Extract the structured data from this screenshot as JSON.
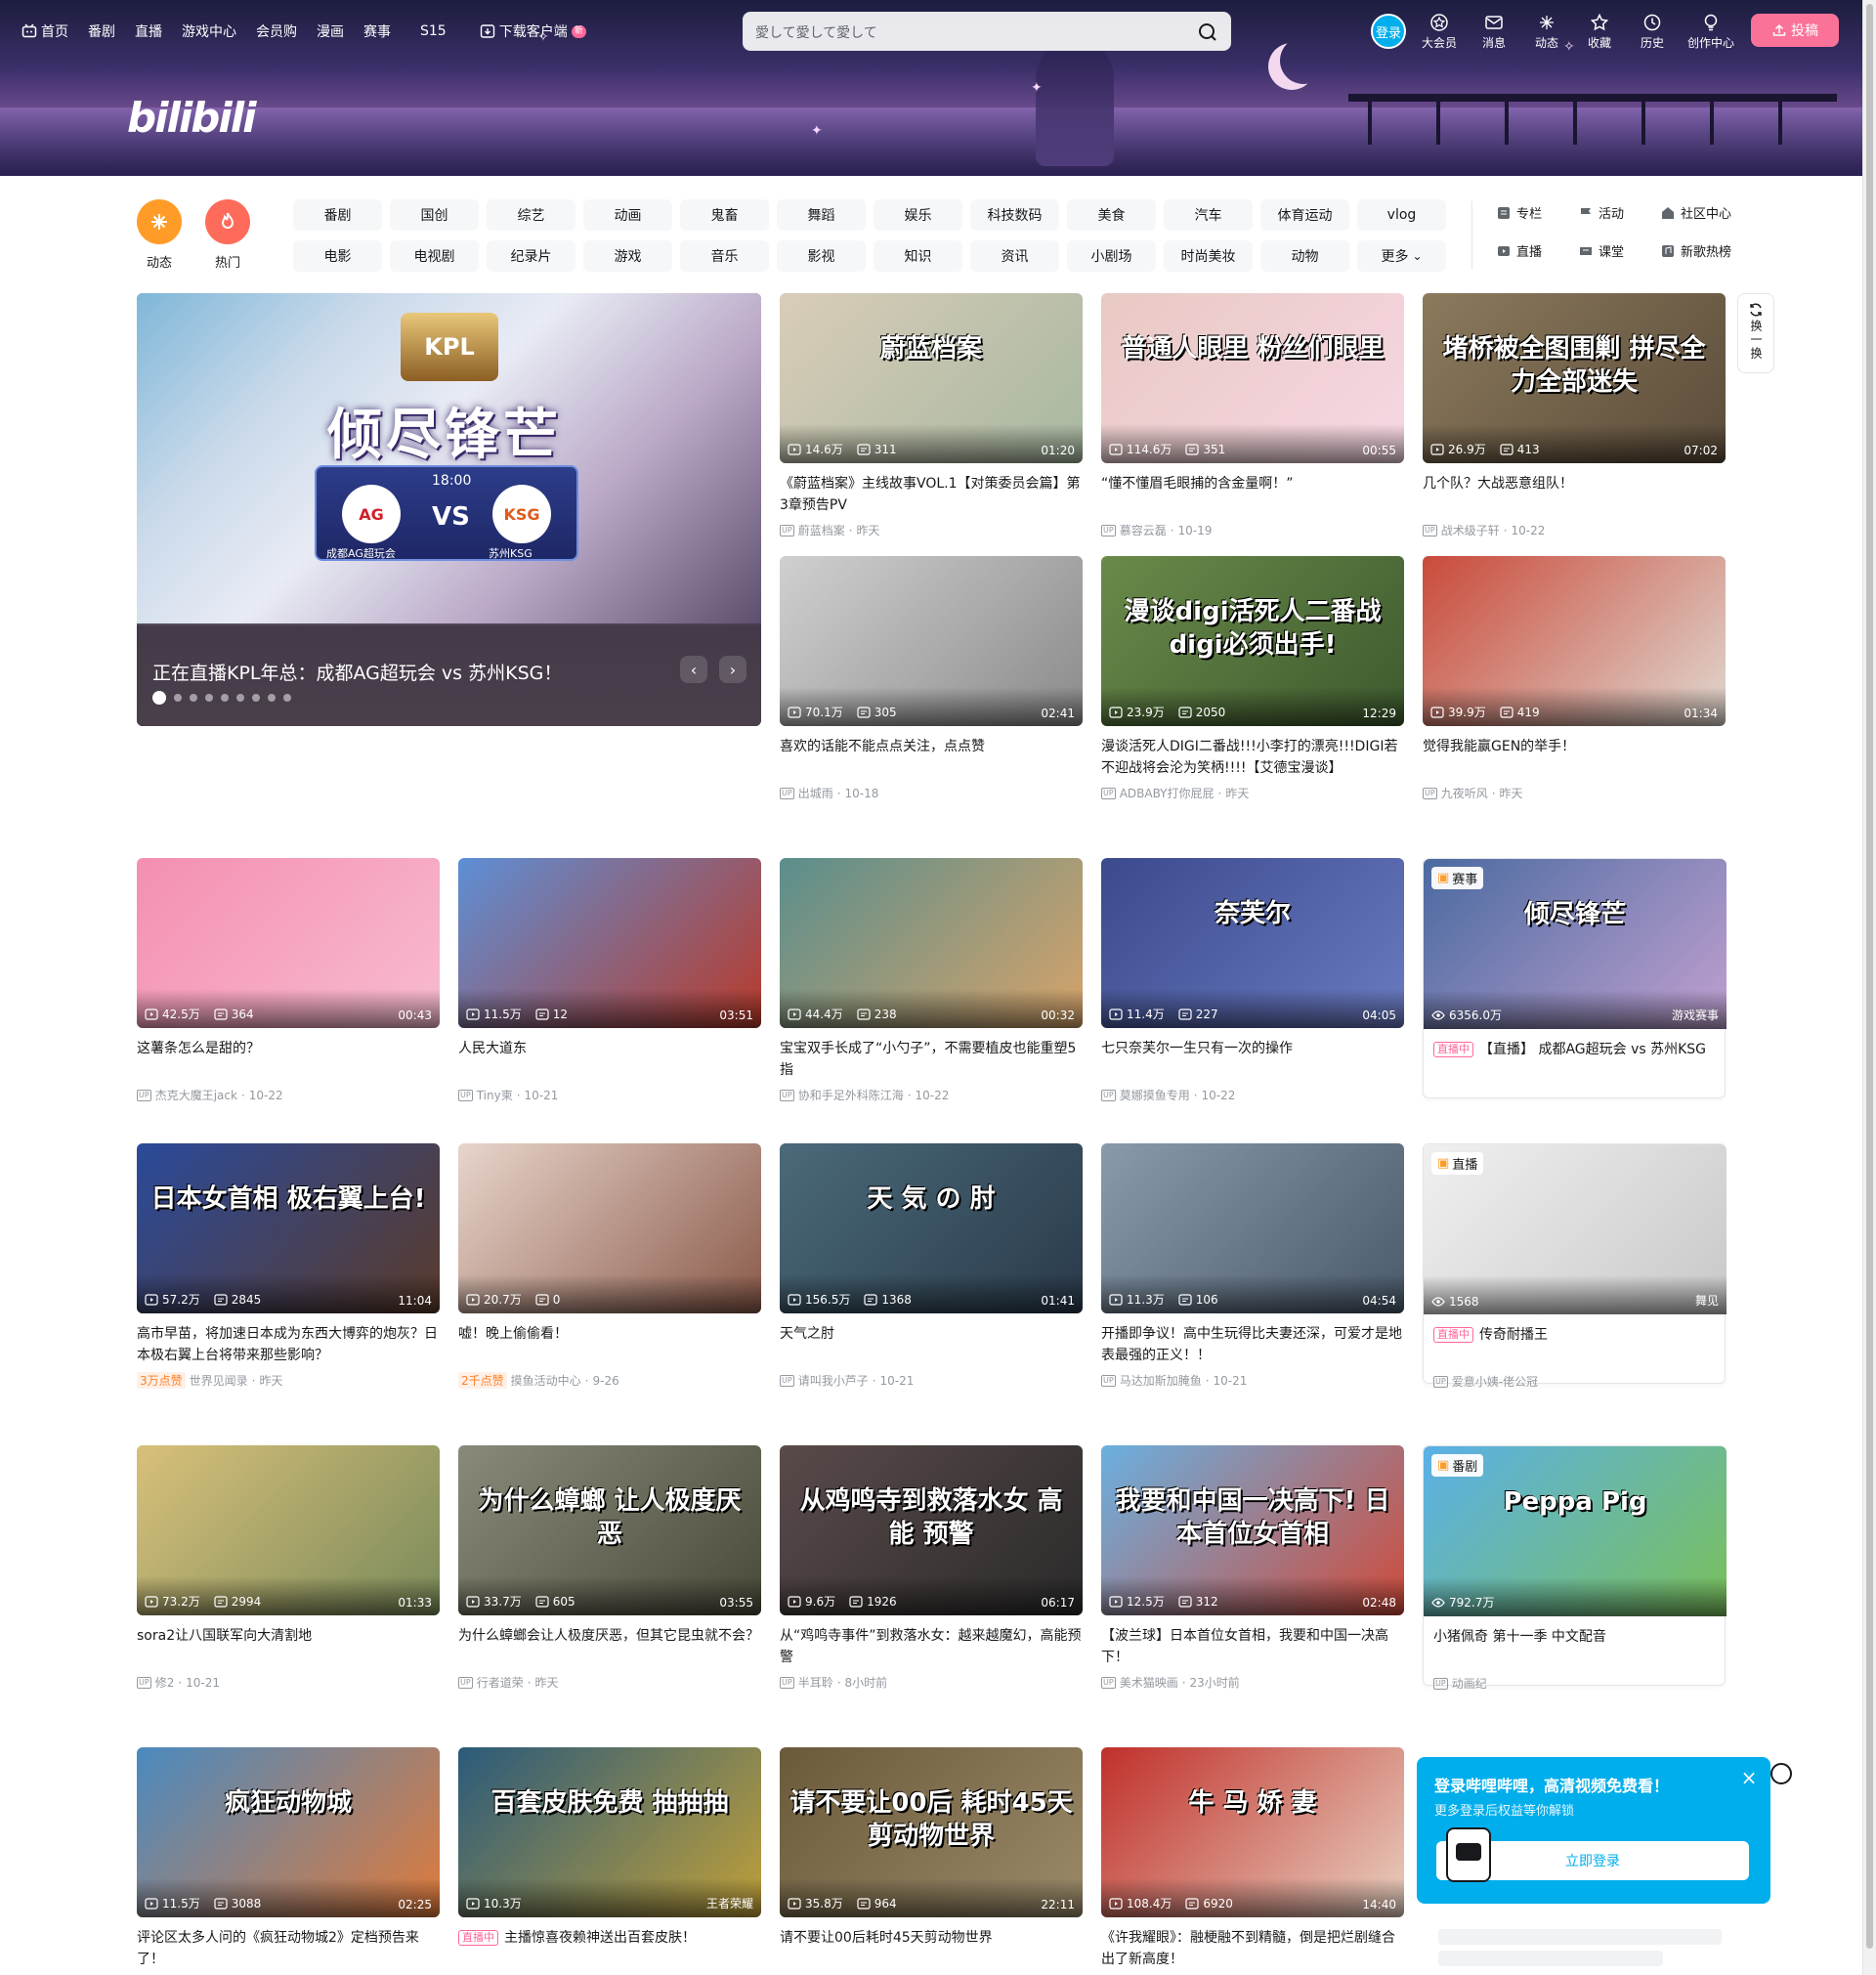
{
  "topnav": {
    "left": [
      {
        "label": "首页",
        "icon": "tv-logo-icon"
      },
      {
        "label": "番剧"
      },
      {
        "label": "直播"
      },
      {
        "label": "游戏中心"
      },
      {
        "label": "会员购"
      },
      {
        "label": "漫画"
      },
      {
        "label": "赛事"
      },
      {
        "label": "S15"
      },
      {
        "label": "下载客户端",
        "icon": "download-icon",
        "badge": "新"
      }
    ],
    "search_placeholder": "愛して愛して愛して",
    "login": "登录",
    "right": [
      {
        "label": "大会员",
        "icon": "vip-icon"
      },
      {
        "label": "消息",
        "icon": "message-icon"
      },
      {
        "label": "动态",
        "icon": "dynamic-icon"
      },
      {
        "label": "收藏",
        "icon": "favorite-icon"
      },
      {
        "label": "历史",
        "icon": "history-icon"
      },
      {
        "label": "创作中心",
        "icon": "creator-icon"
      }
    ],
    "upload": "投稿",
    "logo": "bilibili"
  },
  "quick": [
    {
      "label": "动态",
      "color": "#ff9c28"
    },
    {
      "label": "热门",
      "color": "#ff6b5a"
    }
  ],
  "channels": [
    "番剧",
    "国创",
    "综艺",
    "动画",
    "鬼畜",
    "舞蹈",
    "娱乐",
    "科技数码",
    "美食",
    "汽车",
    "体育运动",
    "vlog",
    "电影",
    "电视剧",
    "纪录片",
    "游戏",
    "音乐",
    "影视",
    "知识",
    "资讯",
    "小剧场",
    "时尚美妆",
    "动物",
    "更多"
  ],
  "channel_links": [
    {
      "label": "专栏",
      "icon": "column-icon"
    },
    {
      "label": "活动",
      "icon": "activity-icon"
    },
    {
      "label": "社区中心",
      "icon": "community-icon"
    },
    {
      "label": "直播",
      "icon": "live-icon"
    },
    {
      "label": "课堂",
      "icon": "classroom-icon"
    },
    {
      "label": "新歌热榜",
      "icon": "music-chart-icon"
    }
  ],
  "carousel": {
    "title": "正在直播KPL年总：成都AG超玩会 vs 苏州KSG！",
    "slogan": "倾尽锋芒",
    "logo": "KPL",
    "time": "18:00",
    "vs": "VS",
    "team_a": "成都AG超玩会",
    "team_a_short": "AG",
    "team_b": "苏州KSG",
    "team_b_short": "KSG",
    "dots": 9,
    "active_dot": 0
  },
  "refresh_label": "换一换",
  "videos": [
    {
      "title": "《蔚蓝档案》主线故事VOL.1【对策委员会篇】第3章预告PV",
      "up": "蔚蓝档案",
      "date": "昨天",
      "views": "14.6万",
      "danmaku": "311",
      "dur": "01:20",
      "overlay": "蔚蓝档案",
      "c1": "#d9cdb8",
      "c2": "#a7b7a1"
    },
    {
      "title": "“懂不懂眉毛眼捕的含金量啊！”",
      "up": "慕容云磊",
      "date": "10-19",
      "views": "114.6万",
      "danmaku": "351",
      "dur": "00:55",
      "overlay": "普通人眼里 粉丝们眼里",
      "c1": "#e8c9c3",
      "c2": "#f7d7e3"
    },
    {
      "title": "几个队？大战恶意组队！",
      "up": "战术级子轩",
      "date": "10-22",
      "views": "26.9万",
      "danmaku": "413",
      "dur": "07:02",
      "overlay": "堵桥被全图围剿 拼尽全力全部迷失",
      "c1": "#8b7a5c",
      "c2": "#5b4c3a"
    },
    {
      "title": "喜欢的话能不能点点关注，点点赞",
      "up": "出城雨",
      "date": "10-18",
      "views": "70.1万",
      "danmaku": "305",
      "dur": "02:41",
      "overlay": "",
      "c1": "#d0d0d0",
      "c2": "#8a8a8a"
    },
    {
      "title": "漫谈活死人DIGI二番战!!!小李打的漂亮!!!DIGI若不迎战将会沦为笑柄!!!!【艾德宝漫谈】",
      "up": "ADBABY打你屁屁",
      "date": "昨天",
      "views": "23.9万",
      "danmaku": "2050",
      "dur": "12:29",
      "overlay": "漫谈digi活死人二番战 digi必须出手!",
      "c1": "#6a8a4a",
      "c2": "#3d5a2e"
    },
    {
      "title": "觉得我能赢GEN的举手！",
      "up": "九夜听风",
      "date": "昨天",
      "views": "39.9万",
      "danmaku": "419",
      "dur": "01:34",
      "overlay": "",
      "c1": "#c94a3a",
      "c2": "#e0d8d0"
    },
    {
      "title": "这薯条怎么是甜的？",
      "up": "杰克大魔王jack",
      "date": "10-22",
      "views": "42.5万",
      "danmaku": "364",
      "dur": "00:43",
      "overlay": "",
      "c1": "#f48fb1",
      "c2": "#f8bbd0"
    },
    {
      "title": "人民大道东",
      "up": "Tiny柬",
      "date": "10-21",
      "views": "11.5万",
      "danmaku": "12",
      "dur": "03:51",
      "overlay": "",
      "c1": "#5d8fd6",
      "c2": "#b83a2a"
    },
    {
      "title": "宝宝双手长成了“小勺子”，不需要植皮也能重塑5指",
      "up": "协和手足外科陈江海",
      "date": "10-22",
      "views": "44.4万",
      "danmaku": "238",
      "dur": "00:32",
      "overlay": "",
      "c1": "#5a8e8c",
      "c2": "#d6a36a"
    },
    {
      "title": "七只奈芙尔一生只有一次的操作",
      "up": "莫娜摸鱼专用",
      "date": "10-22",
      "views": "11.4万",
      "danmaku": "227",
      "dur": "04:05",
      "overlay": "奈芙尔",
      "c1": "#3b4a8c",
      "c2": "#6a7ac0"
    },
    {
      "title": "高市早苗，将加速日本成为东西大博弈的炮灰？日本极右翼上台将带来那些影响？",
      "up": "世界见闻录",
      "date": "昨天",
      "views": "57.2万",
      "danmaku": "2845",
      "dur": "11:04",
      "likes": "3万点赞",
      "overlay": "日本女首相 极右翼上台!",
      "c1": "#2a4a9a",
      "c2": "#5a3a2a"
    },
    {
      "title": "嘘！晚上偷偷看！",
      "up": "摸鱼活动中心",
      "date": "9-26",
      "views": "20.7万",
      "danmaku": "0",
      "dur": "",
      "likes": "2千点赞",
      "overlay": "",
      "c1": "#e8d5cc",
      "c2": "#8a5a4a"
    },
    {
      "title": "天气之肘",
      "up": "请叫我小芦子",
      "date": "10-21",
      "views": "156.5万",
      "danmaku": "1368",
      "dur": "01:41",
      "overlay": "天 気 の 肘",
      "c1": "#4a6a7a",
      "c2": "#2a3a4a"
    },
    {
      "title": "开播即争议！高中生玩得比夫妻还深，可爱才是地表最强的正义！！",
      "up": "马达加斯加腌鱼",
      "date": "10-21",
      "views": "11.3万",
      "danmaku": "106",
      "dur": "04:54",
      "overlay": "",
      "c1": "#8a9aaa",
      "c2": "#4a5a6a"
    },
    {
      "title": "sora2让八国联军向大清割地",
      "up": "修2",
      "date": "10-21",
      "views": "73.2万",
      "danmaku": "2994",
      "dur": "01:33",
      "overlay": "",
      "c1": "#d8c07a",
      "c2": "#7a8a5a"
    },
    {
      "title": "为什么蟑螂会让人极度厌恶，但其它昆虫就不会？",
      "up": "行者道荣",
      "date": "昨天",
      "views": "33.7万",
      "danmaku": "605",
      "dur": "03:55",
      "overlay": "为什么蟑螂 让人极度厌恶",
      "c1": "#8a8a7a",
      "c2": "#4a4a3a"
    },
    {
      "title": "从“鸡鸣寺事件”到救落水女：越来越魔幻，高能预警",
      "up": "半耳聆",
      "date": "8小时前",
      "views": "9.6万",
      "danmaku": "1926",
      "dur": "06:17",
      "overlay": "从鸡鸣寺到救落水女 高能 预警",
      "c1": "#5a4a4a",
      "c2": "#2a2a2a"
    },
    {
      "title": "【波兰球】日本首位女首相，我要和中国一决高下！",
      "up": "美术猫映画",
      "date": "23小时前",
      "views": "12.5万",
      "danmaku": "312",
      "dur": "02:48",
      "overlay": "我要和中国一决高下! 日本首位女首相",
      "c1": "#6ab0e0",
      "c2": "#d04a3a"
    },
    {
      "title": "评论区太多人问的《疯狂动物城2》定档预告来了！",
      "up": "",
      "date": "",
      "views": "11.5万",
      "danmaku": "3088",
      "dur": "02:25",
      "overlay": "疯狂动物城",
      "c1": "#4a8ac0",
      "c2": "#e07a3a"
    },
    {
      "title": "主播惊喜夜赖神送出百套皮肤！",
      "up": "",
      "date": "",
      "views": "10.3万",
      "danmaku": "",
      "dur": "",
      "live": true,
      "badge": "王者荣耀",
      "overlay": "百套皮肤免费 抽抽抽",
      "c1": "#2a5a7a",
      "c2": "#c0a03a"
    },
    {
      "title": "请不要让00后耗时45天剪动物世界",
      "up": "",
      "date": "",
      "views": "35.8万",
      "danmaku": "964",
      "dur": "22:11",
      "overlay": "请不要让00后 耗时45天 剪动物世界",
      "c1": "#6a5a3a",
      "c2": "#9a8a6a"
    },
    {
      "title": "《许我耀眼》：融梗融不到精髓，倒是把烂剧缝合出了新高度！",
      "up": "",
      "date": "",
      "views": "108.4万",
      "danmaku": "6920",
      "dur": "14:40",
      "overlay": "牛 马 娇 妻",
      "c1": "#c0302a",
      "c2": "#e8d0c0"
    }
  ],
  "live_cards": [
    {
      "tag": "赛事",
      "title": "【直播】 成都AG超玩会 vs 苏州KSG",
      "live_label": "直播中",
      "watch": "6356.0万",
      "corner": "游戏赛事",
      "c1": "#4a6aa0",
      "c2": "#c0a0d0",
      "overlay": "倾尽锋芒"
    },
    {
      "tag": "直播",
      "title": "传奇耐播王",
      "live_label": "直播中",
      "watch": "1568",
      "corner": "舞见",
      "up": "爱意小姨-佬公冠",
      "c1": "#f0f0f0",
      "c2": "#c8c8c8",
      "overlay": ""
    },
    {
      "tag": "番剧",
      "title": "小猪佩奇 第十一季 中文配音",
      "watch": "792.7万",
      "up": "动画纪",
      "c1": "#5ab0e8",
      "c2": "#7ac05a",
      "overlay": "Peppa Pig"
    }
  ],
  "popup": {
    "title": "登录哔哩哔哩，高清视频免费看！",
    "subtitle": "更多登录后权益等你解锁",
    "button": "立即登录"
  }
}
